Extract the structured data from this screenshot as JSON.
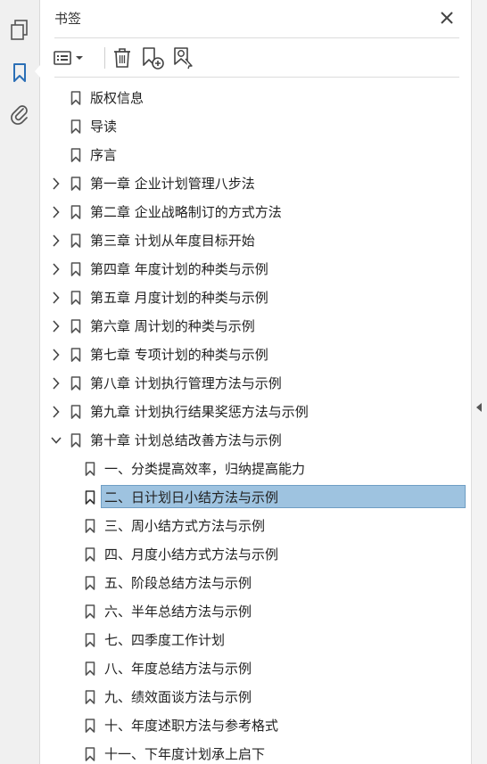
{
  "panel": {
    "title": "书签"
  },
  "colors": {
    "accent": "#2b6fb6",
    "selected_bg": "#9ec3e0",
    "selected_border": "#6f9ec4"
  },
  "rail": {
    "items": [
      {
        "icon": "pages-icon"
      },
      {
        "icon": "bookmark-icon",
        "active": true
      },
      {
        "icon": "attachment-icon"
      }
    ]
  },
  "toolbar": {
    "items": [
      {
        "icon": "options-menu-icon"
      },
      {
        "icon": "delete-icon"
      },
      {
        "icon": "new-bookmark-icon"
      },
      {
        "icon": "find-bookmark-icon"
      }
    ]
  },
  "bookmarks": [
    {
      "label": "版权信息",
      "level": 0,
      "expandable": false
    },
    {
      "label": "导读",
      "level": 0,
      "expandable": false
    },
    {
      "label": "序言",
      "level": 0,
      "expandable": false
    },
    {
      "label": "第一章 企业计划管理八步法",
      "level": 0,
      "expandable": true,
      "expanded": false
    },
    {
      "label": "第二章 企业战略制订的方式方法",
      "level": 0,
      "expandable": true,
      "expanded": false
    },
    {
      "label": "第三章 计划从年度目标开始",
      "level": 0,
      "expandable": true,
      "expanded": false
    },
    {
      "label": "第四章 年度计划的种类与示例",
      "level": 0,
      "expandable": true,
      "expanded": false
    },
    {
      "label": "第五章 月度计划的种类与示例",
      "level": 0,
      "expandable": true,
      "expanded": false
    },
    {
      "label": "第六章 周计划的种类与示例",
      "level": 0,
      "expandable": true,
      "expanded": false
    },
    {
      "label": "第七章 专项计划的种类与示例",
      "level": 0,
      "expandable": true,
      "expanded": false
    },
    {
      "label": "第八章 计划执行管理方法与示例",
      "level": 0,
      "expandable": true,
      "expanded": false
    },
    {
      "label": "第九章 计划执行结果奖惩方法与示例",
      "level": 0,
      "expandable": true,
      "expanded": false
    },
    {
      "label": "第十章 计划总结改善方法与示例",
      "level": 0,
      "expandable": true,
      "expanded": true
    },
    {
      "label": "一、分类提高效率，归纳提高能力",
      "level": 1,
      "expandable": false
    },
    {
      "label": "二、日计划日小结方法与示例",
      "level": 1,
      "expandable": false,
      "selected": true
    },
    {
      "label": "三、周小结方式方法与示例",
      "level": 1,
      "expandable": false
    },
    {
      "label": "四、月度小结方式方法与示例",
      "level": 1,
      "expandable": false
    },
    {
      "label": "五、阶段总结方法与示例",
      "level": 1,
      "expandable": false
    },
    {
      "label": "六、半年总结方法与示例",
      "level": 1,
      "expandable": false
    },
    {
      "label": "七、四季度工作计划",
      "level": 1,
      "expandable": false
    },
    {
      "label": "八、年度总结方法与示例",
      "level": 1,
      "expandable": false
    },
    {
      "label": "九、绩效面谈方法与示例",
      "level": 1,
      "expandable": false
    },
    {
      "label": "十、年度述职方法与参考格式",
      "level": 1,
      "expandable": false
    },
    {
      "label": "十一、下年度计划承上启下",
      "level": 1,
      "expandable": false
    }
  ]
}
